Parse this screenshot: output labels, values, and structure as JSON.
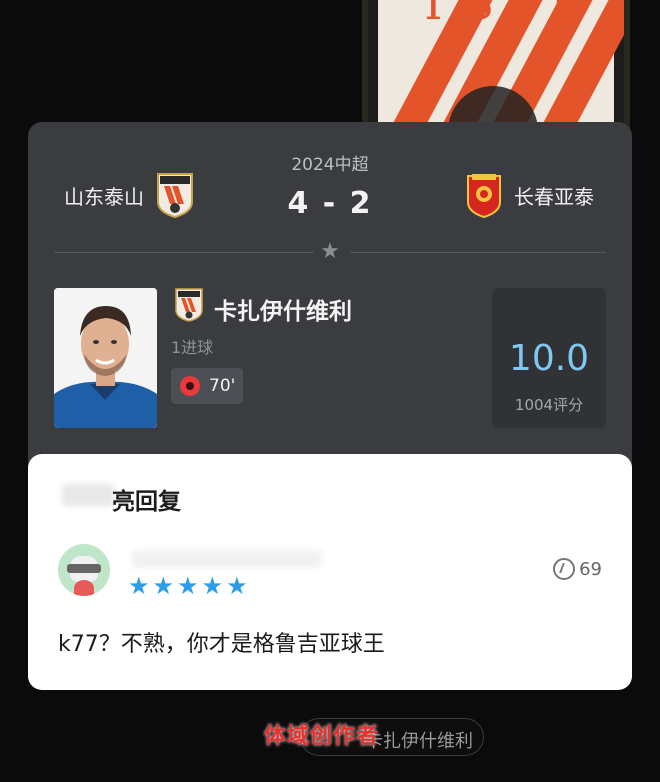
{
  "match": {
    "competition": "2024中超",
    "score": "4 - 2",
    "home_team": "山东泰山",
    "away_team": "长春亚泰"
  },
  "player": {
    "name": "卡扎伊什维利",
    "goals": "1进球",
    "event_minute": "70'",
    "rating": "10.0",
    "rating_count": "1004评分"
  },
  "reply": {
    "title": "亮回复",
    "likes": "69",
    "stars": 5,
    "comment": "k77？不熟，你才是格鲁吉亚球王"
  },
  "bottom": {
    "pill_text": "卡扎伊什维利",
    "watermark": "体域创作者"
  },
  "colors": {
    "card_bg": "#3a3c40",
    "rating_color": "#7fc8f2",
    "star_color": "#2e9de8",
    "watermark_color": "#e8312f"
  }
}
